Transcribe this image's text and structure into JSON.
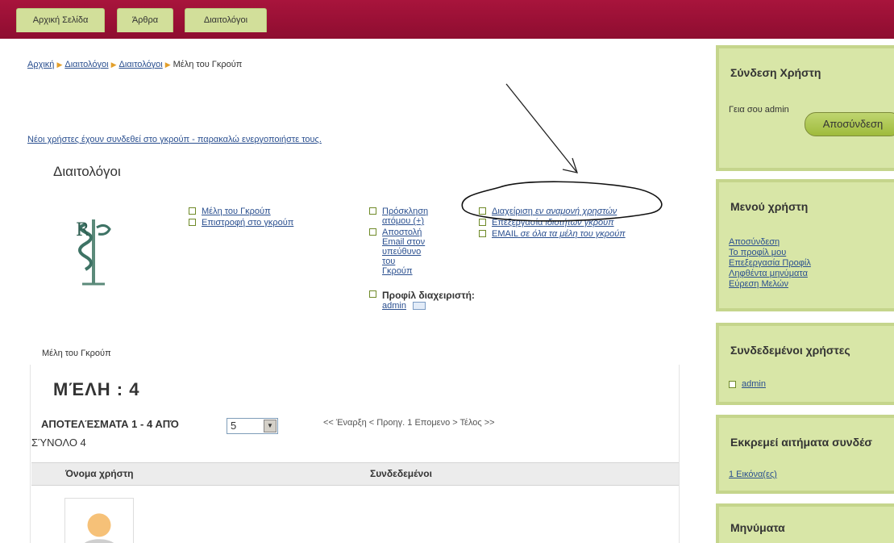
{
  "nav": {
    "tabs": [
      "Αρχική Σελίδα",
      "Άρθρα",
      "Διαιτολόγοι"
    ]
  },
  "breadcrumb": [
    "Αρχική",
    "Διαιτολόγοι",
    "Διαιτολόγοι",
    "Μέλη του Γκρούπ"
  ],
  "notice": "Νέοι χρήστες έχουν συνδεθεί στο γκρούπ - παρακαλώ ενεργοποιήστε τους.",
  "group": {
    "title": "Διαιτολόγοι",
    "links_col1": [
      "Μέλη του Γκρούπ",
      "Επιστροφή στο γκρούπ"
    ],
    "links_col2": [
      "Πρόσκληση ατόμου (+)",
      "Αποστολή Email στον υπεύθυνο του Γκρούπ"
    ],
    "links_col3": [
      "Διαχείριση",
      "εν αναμονή χρηστών",
      "Επεξεργασία",
      "ιδιοτήτων γκρούπ",
      "EMAIL",
      "σε όλα τα μέλη του γκρούπ"
    ],
    "admin_profile_title": "Προφίλ διαχειριστή:",
    "admin_name": "admin"
  },
  "members": {
    "label": "Μέλη του Γκρούπ",
    "count_title": "ΜΈΛΗ : 4",
    "results_text": "ΑΠΟΤΕΛΈΣΜΑΤΑ 1 - 4 ΑΠΌ",
    "total_text": "ΣΎΝΟΛΟ 4",
    "page_size": "5",
    "pager": "<< Έναρξη < Προηγ. 1 Επομενο > Τέλος >>",
    "columns": [
      "Όνομα χρήστη",
      "Συνδεδεμένοι"
    ]
  },
  "sidebar": {
    "login": {
      "title": "Σύνδεση Χρήστη",
      "greeting": "Γεια σου admin",
      "logout_button": "Αποσύνδεση"
    },
    "user_menu": {
      "title": "Μενού χρήστη",
      "items": [
        "Αποσύνδεση",
        "Το προφίλ μου",
        "Επεξεργασία Προφίλ",
        "Ληφθέντα μηνύματα",
        "Εύρεση Μελών"
      ]
    },
    "online": {
      "title": "Συνδεδεμένοι χρήστες",
      "user": "admin"
    },
    "pending": {
      "title": "Εκκρεμεί αιτήματα συνδέσ",
      "link": "1 Εικόνα(ες)"
    },
    "messages": {
      "title": "Μηνύματα"
    }
  },
  "colors": {
    "topbar": "#8e0d30",
    "tab": "#d2df9a",
    "sidebar": "#d8e6a7",
    "link": "#2a4f8f"
  },
  "icons": [
    "caduceus-logo",
    "checkbox-icon",
    "mail-icon",
    "breadcrumb-arrow-icon",
    "user-avatar-icon",
    "select-arrow-icon"
  ]
}
